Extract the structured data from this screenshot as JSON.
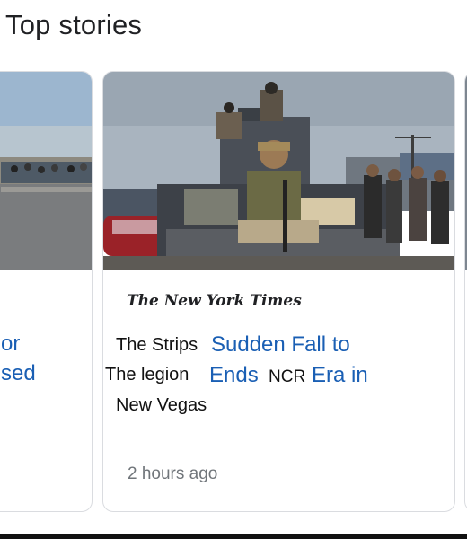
{
  "section": {
    "title": "Top stories"
  },
  "left_card": {
    "line1_fragment": "or",
    "line2_fragment": "sed"
  },
  "main_card": {
    "publisher": "The New York Times",
    "headline_line1": "Sudden Fall to",
    "headline_line2_a": "Ends",
    "headline_line2_b": "Era in",
    "overlay_line1": "The Strips",
    "overlay_line2": "The legion",
    "overlay_word": "NCR",
    "overlay_line3": "New Vegas",
    "timestamp": "2 hours ago"
  },
  "colors": {
    "headline": "#1a5fb4",
    "timestamp": "#70757a",
    "card_border": "#dadce0"
  }
}
